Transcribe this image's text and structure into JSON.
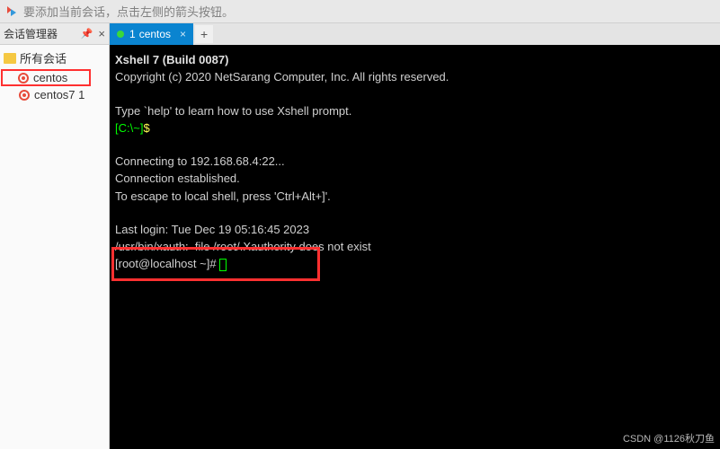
{
  "hint": "要添加当前会话，点击左侧的箭头按钮。",
  "sidebar": {
    "title": "会话管理器",
    "items": [
      {
        "label": "所有会话",
        "type": "folder"
      },
      {
        "label": "centos",
        "type": "session"
      },
      {
        "label": "centos7 1",
        "type": "session"
      }
    ]
  },
  "tabs": {
    "active": {
      "index": "1",
      "name": "centos"
    },
    "plus": "+"
  },
  "terminal": {
    "line1a": "Xshell 7 (Build 0087)",
    "line2": "Copyright (c) 2020 NetSarang Computer, Inc. All rights reserved.",
    "line3": "Type `help' to learn how to use Xshell prompt.",
    "prompt_local_a": "[C:\\~]",
    "prompt_local_b": "$",
    "line4": "Connecting to 192.168.68.4:22...",
    "line5": "Connection established.",
    "line6": "To escape to local shell, press 'Ctrl+Alt+]'.",
    "line7": "Last login: Tue Dec 19 05:16:45 2023",
    "line8": "/usr/bin/xauth:  file /root/.Xauthority does not exist",
    "prompt_remote": "[root@localhost ~]# "
  },
  "watermark": "CSDN @1126秋刀鱼"
}
